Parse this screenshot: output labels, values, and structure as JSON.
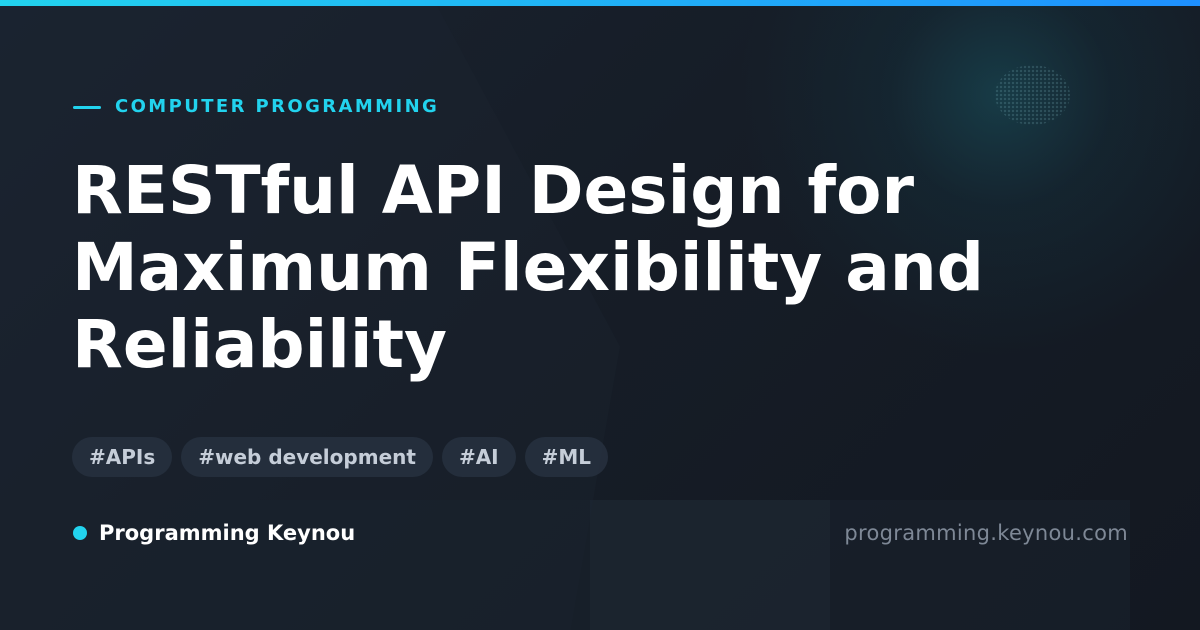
{
  "category": "COMPUTER PROGRAMMING",
  "title": "RESTful API Design for Maximum Flexibility and Reliability",
  "tags": [
    "#APIs",
    "#web development",
    "#AI",
    "#ML"
  ],
  "brand": {
    "name": "Programming Keynou",
    "url": "programming.keynou.com"
  },
  "colors": {
    "accent": "#22d3ee",
    "accent_gradient_end": "#1e90ff",
    "background": "#141a23",
    "title_text": "#ffffff",
    "tag_background": "#26303e",
    "tag_text": "#c5cdd8",
    "url_text": "#7e8896"
  }
}
